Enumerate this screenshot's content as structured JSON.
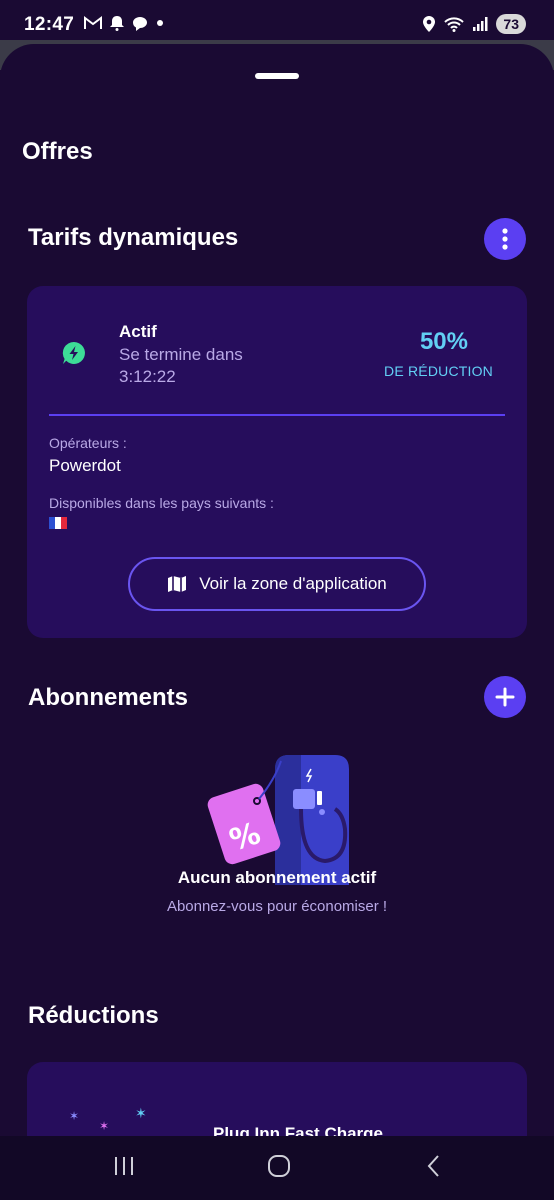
{
  "status": {
    "time": "12:47",
    "battery": "73"
  },
  "page": {
    "title": "Offres"
  },
  "dynamic_pricing": {
    "section_title": "Tarifs dynamiques",
    "status_label": "Actif",
    "ends_in_label": "Se termine dans",
    "timer": "3:12:22",
    "discount_percent": "50%",
    "discount_label": "DE RÉDUCTION",
    "operators_label": "Opérateurs :",
    "operators_value": "Powerdot",
    "countries_label": "Disponibles dans les pays suivants :",
    "map_button_label": "Voir la zone d'application"
  },
  "subscriptions": {
    "section_title": "Abonnements",
    "empty_title": "Aucun abonnement actif",
    "empty_subtitle": "Abonnez-vous pour économiser !"
  },
  "reductions": {
    "section_title": "Réductions",
    "first_card_title": "Plug Inn Fast Charge"
  },
  "colors": {
    "background": "#1a0a33",
    "card": "#260d5c",
    "accent": "#5b3ff2",
    "highlight": "#62cff4",
    "bolt": "#3ddc97"
  },
  "icons": {
    "status_left": [
      "gmail-icon",
      "bell-icon",
      "chat-icon",
      "dot-icon"
    ],
    "status_right": [
      "location-icon",
      "wifi-icon",
      "signal-icon"
    ],
    "more": "more-vertical-icon",
    "add": "plus-icon",
    "bolt": "bolt-icon",
    "map": "map-icon",
    "nav": [
      "recents-icon",
      "home-icon",
      "back-icon"
    ]
  }
}
